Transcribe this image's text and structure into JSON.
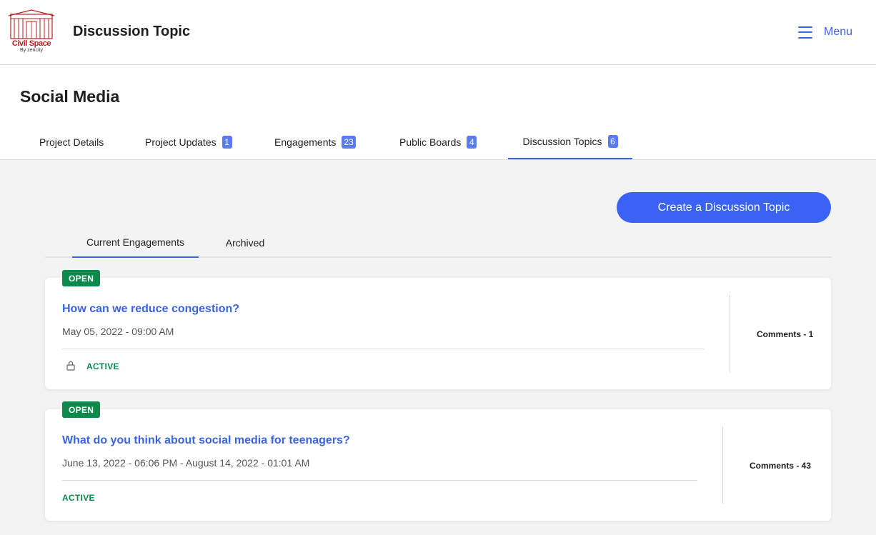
{
  "header": {
    "logo_text": "Civil Space",
    "logo_subtext": "By zencity",
    "title": "Discussion Topic",
    "menu_label": "Menu",
    "menu_icon": "hamburger-icon"
  },
  "project": {
    "title": "Social Media",
    "tabs": [
      {
        "label": "Project Details",
        "count": null,
        "active": false
      },
      {
        "label": "Project Updates",
        "count": "1",
        "active": false
      },
      {
        "label": "Engagements",
        "count": "23",
        "active": false
      },
      {
        "label": "Public Boards",
        "count": "4",
        "active": false
      },
      {
        "label": "Discussion Topics",
        "count": "6",
        "active": true
      }
    ]
  },
  "main": {
    "create_button_label": "Create a Discussion Topic",
    "subtabs": [
      {
        "label": "Current Engagements",
        "active": true
      },
      {
        "label": "Archived",
        "active": false
      }
    ],
    "topics": [
      {
        "status": "OPEN",
        "title": "How can we reduce congestion?",
        "date": "May 05, 2022 - 09:00 AM",
        "state": "ACTIVE",
        "locked": true,
        "comments": "Comments - 1"
      },
      {
        "status": "OPEN",
        "title": "What do you think about social media for teenagers?",
        "date": "June 13, 2022 - 06:06 PM - August 14, 2022 - 01:01 AM",
        "state": "ACTIVE",
        "locked": false,
        "comments": "Comments - 43"
      }
    ]
  },
  "colors": {
    "accent": "#3a63e6",
    "status_green": "#0b8a4b",
    "badge": "#5b7cf0",
    "logo_red": "#b81e1e"
  }
}
